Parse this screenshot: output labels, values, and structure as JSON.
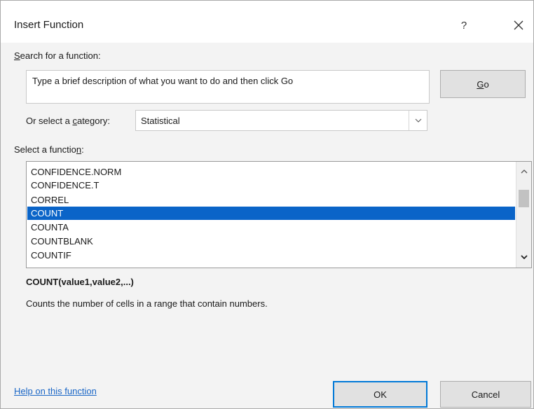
{
  "window": {
    "title": "Insert Function",
    "help_label": "?"
  },
  "search": {
    "label_prefix": "",
    "label_key": "S",
    "label_suffix": "earch for a function:",
    "value": "Type a brief description of what you want to do and then click Go"
  },
  "go_button": {
    "label_key": "G",
    "label_suffix": "o"
  },
  "category": {
    "label_prefix": "Or select a ",
    "label_key": "c",
    "label_suffix": "ategory:",
    "selected": "Statistical"
  },
  "function_list": {
    "label_prefix": "Select a functio",
    "label_key": "n",
    "label_suffix": ":",
    "items": [
      {
        "label": "CONFIDENCE.NORM",
        "selected": false
      },
      {
        "label": "CONFIDENCE.T",
        "selected": false
      },
      {
        "label": "CORREL",
        "selected": false
      },
      {
        "label": "COUNT",
        "selected": true
      },
      {
        "label": "COUNTA",
        "selected": false
      },
      {
        "label": "COUNTBLANK",
        "selected": false
      },
      {
        "label": "COUNTIF",
        "selected": false
      }
    ]
  },
  "details": {
    "signature": "COUNT(value1,value2,...)",
    "description": "Counts the number of cells in a range that contain numbers."
  },
  "footer": {
    "help_link": "Help on this function",
    "ok_label": "OK",
    "cancel_label": "Cancel"
  },
  "colors": {
    "selection": "#0a64c8",
    "link": "#1a66c6",
    "default_button_border": "#0078d7"
  }
}
